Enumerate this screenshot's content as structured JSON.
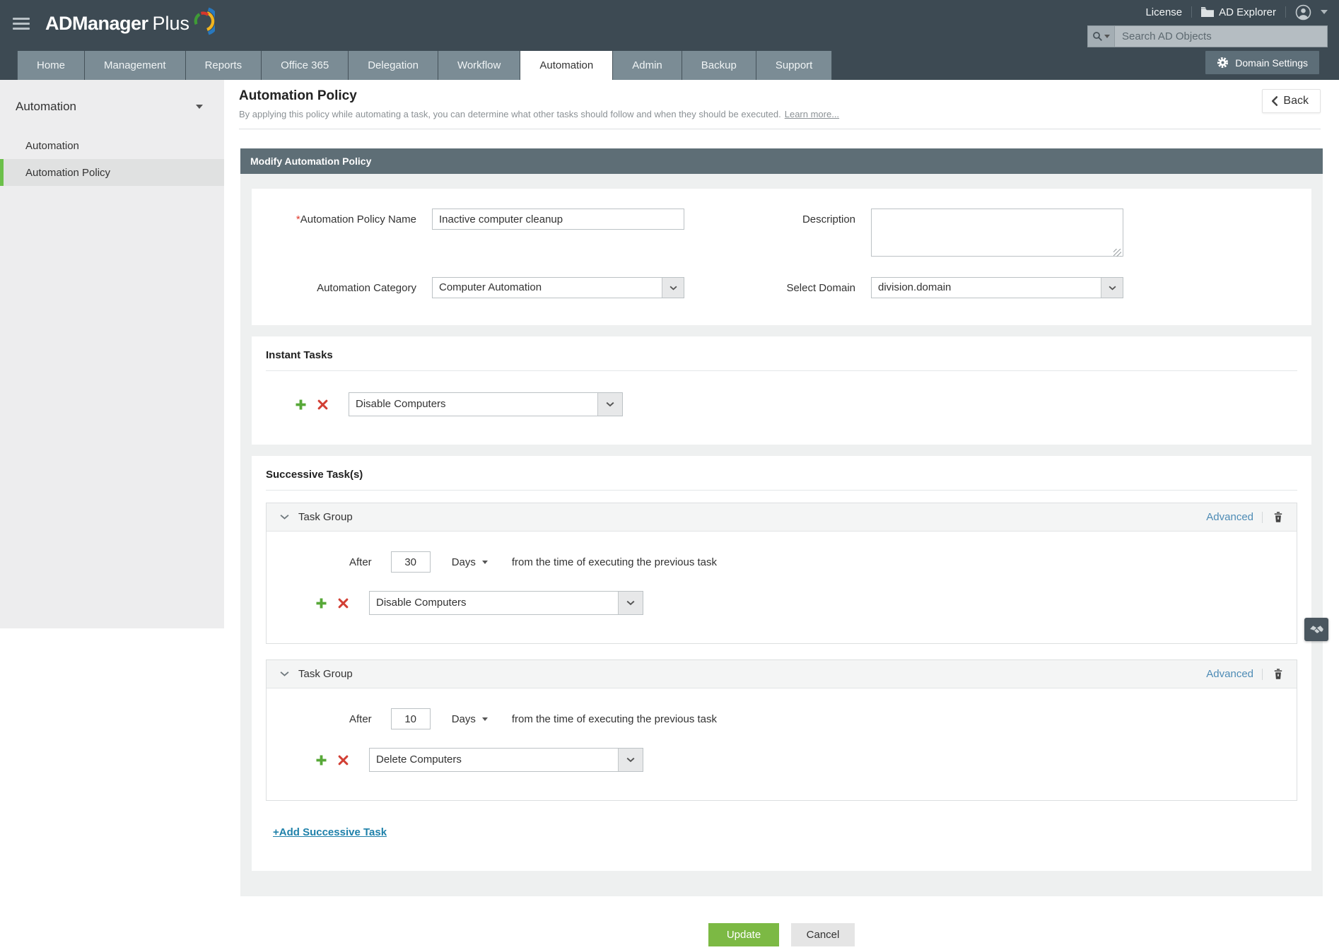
{
  "header": {
    "brand": {
      "name": "ADManager",
      "suffix": "Plus"
    },
    "links": {
      "license": "License",
      "ad_explorer": "AD Explorer"
    },
    "search_placeholder": "Search AD Objects",
    "domain_settings_label": "Domain Settings"
  },
  "nav": {
    "tabs": [
      "Home",
      "Management",
      "Reports",
      "Office 365",
      "Delegation",
      "Workflow",
      "Automation",
      "Admin",
      "Backup",
      "Support"
    ],
    "active_tab": "Automation"
  },
  "sidebar": {
    "section_title": "Automation",
    "items": [
      {
        "label": "Automation",
        "selected": false
      },
      {
        "label": "Automation Policy",
        "selected": true
      }
    ]
  },
  "page": {
    "title": "Automation Policy",
    "description": "By applying this policy while automating a task, you can determine what other tasks should follow and when they should be executed.",
    "learn_more_label": "Learn more...",
    "back_label": "Back"
  },
  "form": {
    "panel_title": "Modify Automation Policy",
    "required_mark": "*",
    "policy_name": {
      "label": "Automation Policy Name",
      "value": "Inactive computer cleanup"
    },
    "description": {
      "label": "Description",
      "value": ""
    },
    "category": {
      "label": "Automation Category",
      "value": "Computer Automation"
    },
    "domain": {
      "label": "Select Domain",
      "value": "division.domain"
    }
  },
  "instant_tasks": {
    "heading": "Instant Tasks",
    "selected_task": "Disable Computers"
  },
  "successive_tasks": {
    "heading": "Successive Task(s)",
    "add_label": "+Add Successive Task",
    "groups": [
      {
        "title": "Task Group",
        "advanced_label": "Advanced",
        "after_label": "After",
        "delay_value": "30",
        "unit": "Days",
        "suffix": "from the time of executing the previous task",
        "selected_task": "Disable Computers"
      },
      {
        "title": "Task Group",
        "advanced_label": "Advanced",
        "after_label": "After",
        "delay_value": "10",
        "unit": "Days",
        "suffix": "from the time of executing the previous task",
        "selected_task": "Delete Computers"
      }
    ]
  },
  "actions": {
    "update_label": "Update",
    "cancel_label": "Cancel"
  },
  "colors": {
    "header_dark": "#3d4a53",
    "tab_gray": "#7b8c95",
    "panel_header": "#5e6e76",
    "accent_green": "#7cb944",
    "selected_green_bar": "#6cc04a",
    "link_blue": "#4d8bb5",
    "add_link_teal": "#1f81aa",
    "danger_red": "#d23f34",
    "plus_green": "#57a838"
  }
}
